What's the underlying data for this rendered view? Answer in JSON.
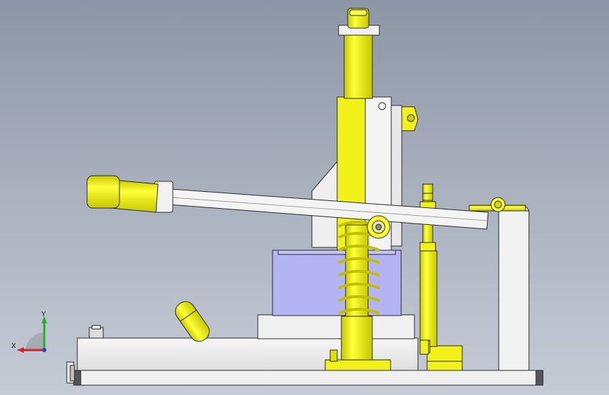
{
  "viewport": {
    "background_top": "#8d96a6",
    "background_bottom": "#c6ccd6"
  },
  "colors": {
    "yellow_part": "#f2f21a",
    "yellow_shade": "#d2d208",
    "white_part": "#f4f4f4",
    "grey_part": "#d6d6d6",
    "blue_block": "#b4b4f4",
    "outline": "#2a2a2a"
  },
  "triad": {
    "x_label": "X",
    "y_label": "Y",
    "x_color": "#e02020",
    "y_color": "#20b020",
    "z_color": "#2040e0"
  }
}
